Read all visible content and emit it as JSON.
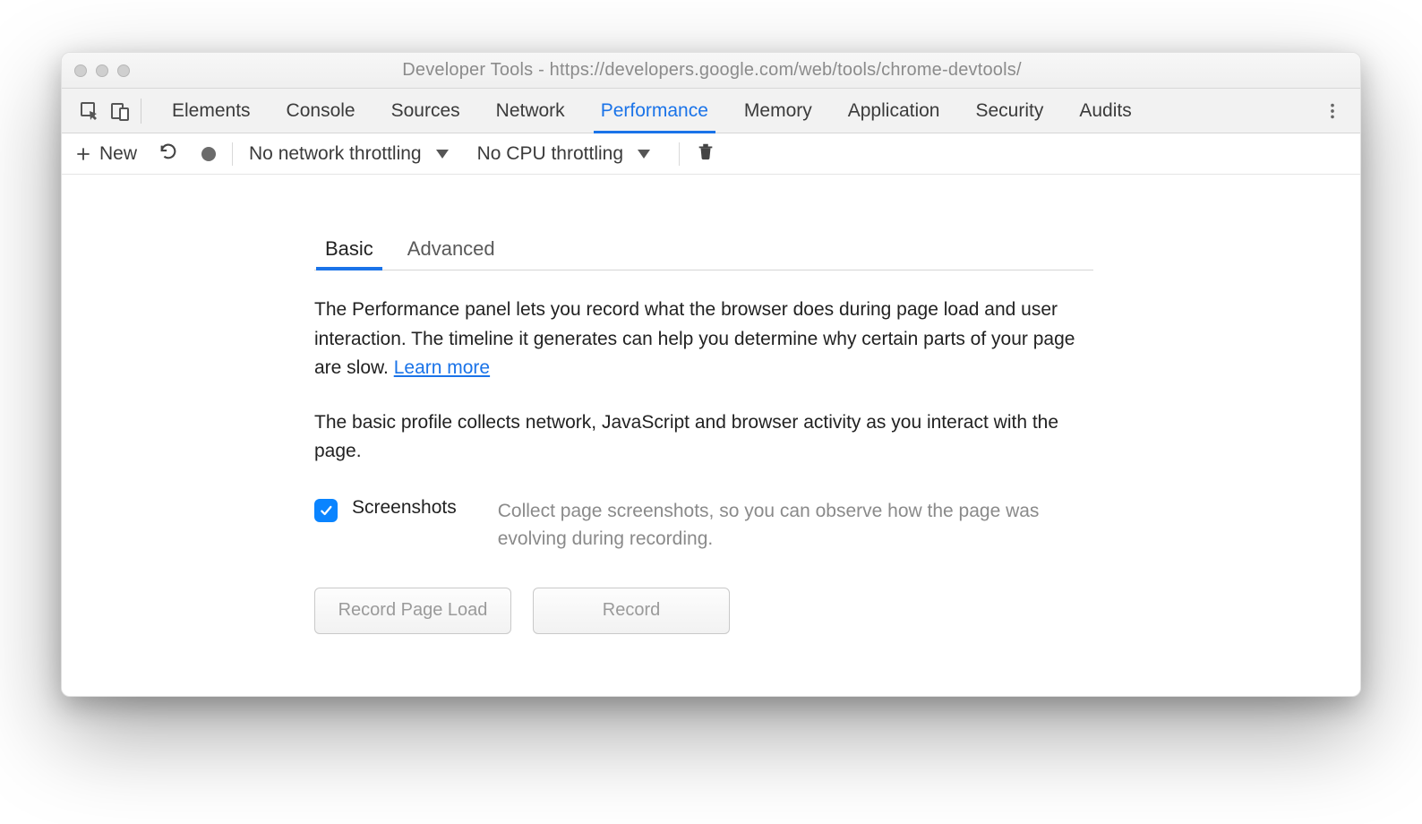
{
  "window": {
    "title": "Developer Tools - https://developers.google.com/web/tools/chrome-devtools/"
  },
  "tabs": {
    "items": [
      "Elements",
      "Console",
      "Sources",
      "Network",
      "Performance",
      "Memory",
      "Application",
      "Security",
      "Audits"
    ],
    "active_index": 4
  },
  "toolbar": {
    "new_label": "New",
    "network_throttling": "No network throttling",
    "cpu_throttling": "No CPU throttling"
  },
  "panel": {
    "sub_tabs": {
      "items": [
        "Basic",
        "Advanced"
      ],
      "active_index": 0
    },
    "paragraph_intro_pre": "The Performance panel lets you record what the browser does during page load and user interaction. The timeline it generates can help you determine why certain parts of your page are slow.  ",
    "learn_more": "Learn more",
    "paragraph_basic": "The basic profile collects network, JavaScript and browser activity as you interact with the page.",
    "screenshots": {
      "checked": true,
      "label": "Screenshots",
      "description": "Collect page screenshots, so you can observe how the page was evolving during recording."
    },
    "buttons": {
      "record_page_load": "Record Page Load",
      "record": "Record"
    }
  },
  "colors": {
    "accent": "#1a73e8",
    "checkbox": "#0a84ff"
  }
}
